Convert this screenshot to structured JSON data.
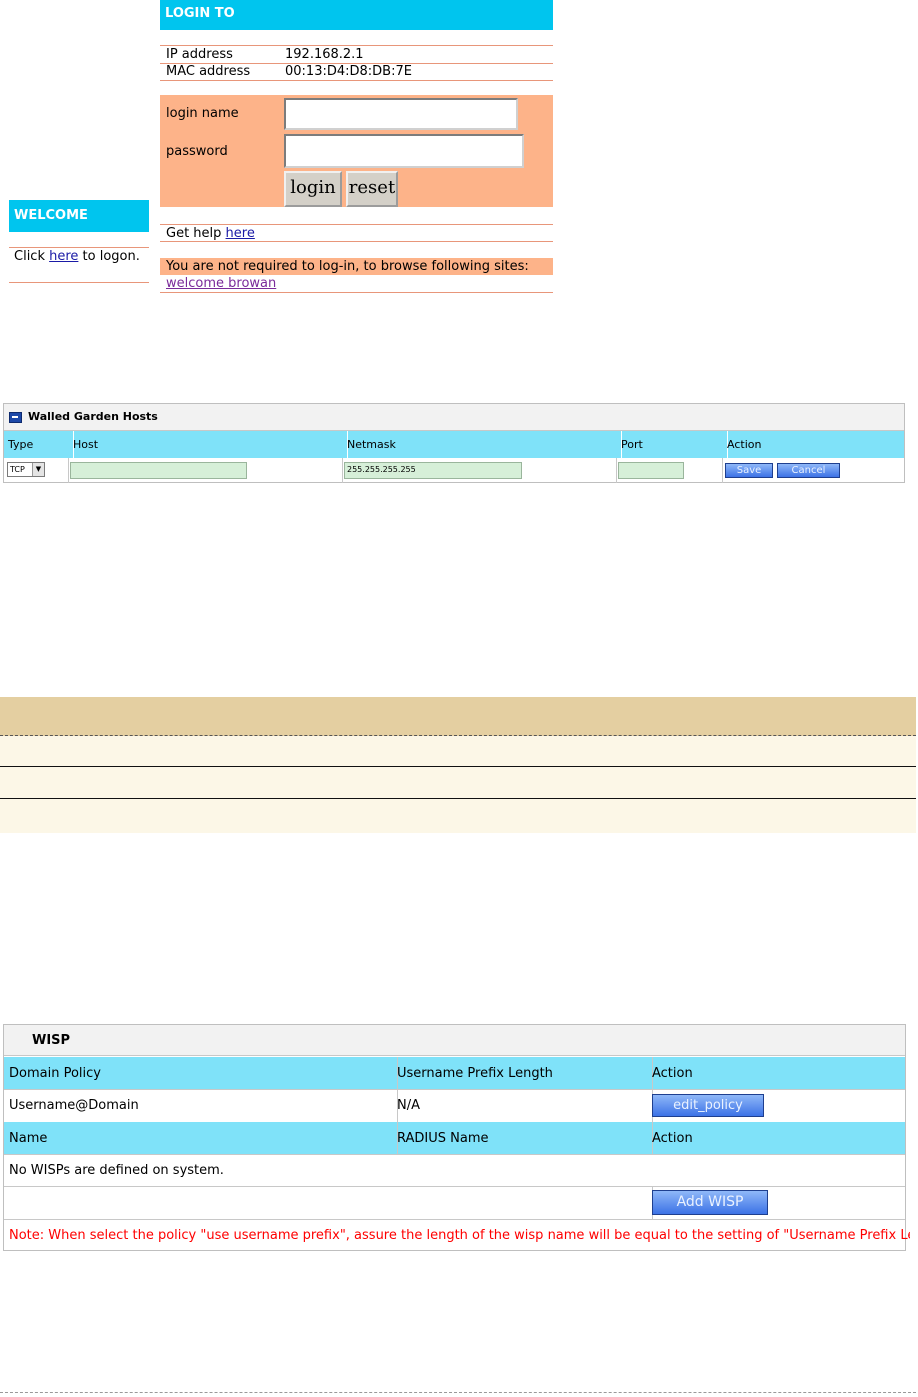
{
  "login": {
    "title": "LOGIN TO",
    "ip_label": "IP address",
    "ip_value": "192.168.2.1",
    "mac_label": "MAC address",
    "mac_value": "00:13:D4:D8:DB:7E",
    "login_name_label": "login name",
    "password_label": "password",
    "login_button": "login",
    "reset_button": "reset",
    "help_text": "Get help ",
    "help_link": "here",
    "notice": "You are not required to log-in, to browse following sites:",
    "site_link": "welcome browan"
  },
  "welcome": {
    "title": "WELCOME",
    "text_before": "Click ",
    "link": "here",
    "text_after": " to logon."
  },
  "walled_garden": {
    "title": "Walled Garden Hosts",
    "columns": [
      "Type",
      "Host",
      "Netmask",
      "Port",
      "Action"
    ],
    "type_value": "TCP",
    "netmask_value": "255.255.255.255",
    "save_button": "Save",
    "cancel_button": "Cancel"
  },
  "wisp": {
    "title": "WISP",
    "policy_header": [
      "Domain Policy",
      "Username Prefix Length",
      "Action"
    ],
    "policy_row": [
      "Username@Domain",
      "N/A"
    ],
    "edit_button": "edit_policy",
    "list_header": [
      "Name",
      "RADIUS Name",
      "Action"
    ],
    "empty_text": "No WISPs are defined on system.",
    "add_button": "Add WISP",
    "note": "Note: When select the policy \"use username prefix\", assure the length of the wisp name will be equal to the setting of \"Username Prefix Length\""
  },
  "colors": {
    "cyan": "#00c5ee",
    "orange": "#fdb389",
    "table_header": "#7fe2f9",
    "beige_header": "#e4cfa1",
    "note_red": "#ff0000"
  }
}
